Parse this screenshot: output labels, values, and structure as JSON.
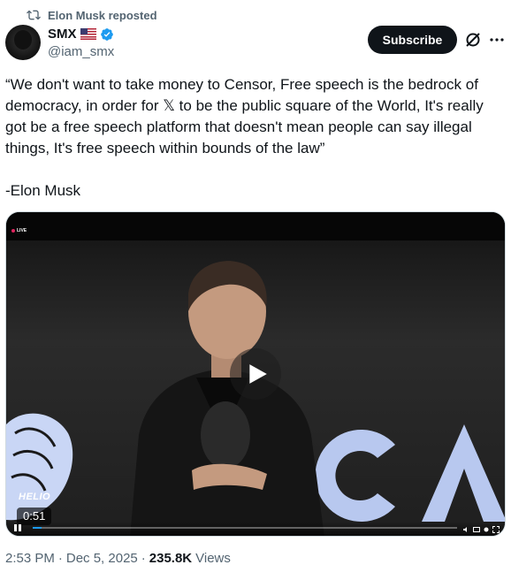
{
  "repost": {
    "label": "Elon Musk reposted",
    "icon": "repost-icon"
  },
  "author": {
    "name": "SMX",
    "handle": "@iam_smx",
    "flag": "us-flag-icon",
    "verified": "verified-badge-icon"
  },
  "actions": {
    "subscribe_label": "Subscribe",
    "grok_icon": "grok-icon",
    "more_icon": "more-icon"
  },
  "tweet": {
    "text": "“We don't want to take money to Censor, Free speech is the bedrock of democracy, in order for 𝕏 to be the public square of the World, It's really got be a free speech platform that doesn't mean people can say illegal things, It's free speech within bounds of the law”\n\n-Elon Musk"
  },
  "video": {
    "live_label": "LIVE",
    "brand_label": "HELIO",
    "duration": "0:51",
    "progress": 0.02,
    "colors": {
      "accent": "#1d9bf0",
      "lion": "#c9d6f5",
      "letters": "#b8c8ef"
    }
  },
  "meta": {
    "time": "2:53 PM",
    "sep1": "·",
    "date": "Dec 5, 2025",
    "sep2": "·",
    "views_count": "235.8K",
    "views_label": "Views"
  }
}
